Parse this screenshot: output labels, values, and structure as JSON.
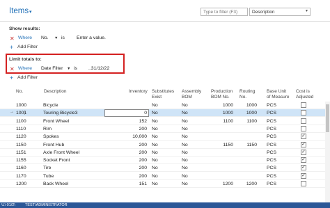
{
  "header": {
    "title": "Items",
    "search_placeholder": "Type to filter (F3)",
    "filter_field": "Description"
  },
  "show_results": {
    "label": "Show results:",
    "where": "Where",
    "field": "No.",
    "op": "is",
    "value": "Enter a value.",
    "add_filter": "Add Filter"
  },
  "limit_totals": {
    "label": "Limit totals to:",
    "where": "Where",
    "field": "Date Filter",
    "op": "is",
    "value": "..31/12/22",
    "add_filter": "Add Filter"
  },
  "columns": {
    "no": "No.",
    "description": "Description",
    "inventory": "Inventory",
    "substitutes_1": "Substitutes",
    "substitutes_2": "Exist",
    "assembly_1": "Assembly",
    "assembly_2": "BOM",
    "production_1": "Production",
    "production_2": "BOM No.",
    "routing_1": "Routing",
    "routing_2": "No.",
    "uom_1": "Base Unit",
    "uom_2": "of Measure",
    "cost_1": "Cost is",
    "cost_2": "Adjusted"
  },
  "rows": [
    {
      "no": "1000",
      "description": "Bicycle",
      "inventory": "",
      "substitutes": "No",
      "assembly": "No",
      "production": "1000",
      "routing": "1000",
      "uom": "PCS",
      "cost_adjusted": false
    },
    {
      "no": "1001",
      "description": "Touring Bicycle3",
      "inventory": "0",
      "substitutes": "No",
      "assembly": "No",
      "production": "1000",
      "routing": "1000",
      "uom": "PCS",
      "cost_adjusted": false
    },
    {
      "no": "1100",
      "description": "Front Wheel",
      "inventory": "152",
      "substitutes": "No",
      "assembly": "No",
      "production": "1100",
      "routing": "1100",
      "uom": "PCS",
      "cost_adjusted": false
    },
    {
      "no": "1110",
      "description": "Rim",
      "inventory": "200",
      "substitutes": "No",
      "assembly": "No",
      "production": "",
      "routing": "",
      "uom": "PCS",
      "cost_adjusted": false
    },
    {
      "no": "1120",
      "description": "Spokes",
      "inventory": "10,000",
      "substitutes": "No",
      "assembly": "No",
      "production": "",
      "routing": "",
      "uom": "PCS",
      "cost_adjusted": true
    },
    {
      "no": "1150",
      "description": "Front Hub",
      "inventory": "200",
      "substitutes": "No",
      "assembly": "No",
      "production": "1150",
      "routing": "1150",
      "uom": "PCS",
      "cost_adjusted": true
    },
    {
      "no": "1151",
      "description": "Axle Front Wheel",
      "inventory": "200",
      "substitutes": "No",
      "assembly": "No",
      "production": "",
      "routing": "",
      "uom": "PCS",
      "cost_adjusted": true
    },
    {
      "no": "1155",
      "description": "Socket Front",
      "inventory": "200",
      "substitutes": "No",
      "assembly": "No",
      "production": "",
      "routing": "",
      "uom": "PCS",
      "cost_adjusted": true
    },
    {
      "no": "1160",
      "description": "Tire",
      "inventory": "200",
      "substitutes": "No",
      "assembly": "No",
      "production": "",
      "routing": "",
      "uom": "PCS",
      "cost_adjusted": true
    },
    {
      "no": "1170",
      "description": "Tube",
      "inventory": "200",
      "substitutes": "No",
      "assembly": "No",
      "production": "",
      "routing": "",
      "uom": "PCS",
      "cost_adjusted": true
    },
    {
      "no": "1200",
      "description": "Back Wheel",
      "inventory": "151",
      "substitutes": "No",
      "assembly": "No",
      "production": "1200",
      "routing": "1200",
      "uom": "PCS",
      "cost_adjusted": false
    }
  ],
  "checkmark": "✓",
  "status_bar": {
    "left": "\\L\\ 01/2\\",
    "user": "TEST\\ADMINISTRATOR"
  },
  "colors": {
    "accent": "#1f6fb7",
    "highlight_border": "#d42121",
    "selected_row": "#cfe4f7",
    "delete_icon": "#c8312f"
  }
}
